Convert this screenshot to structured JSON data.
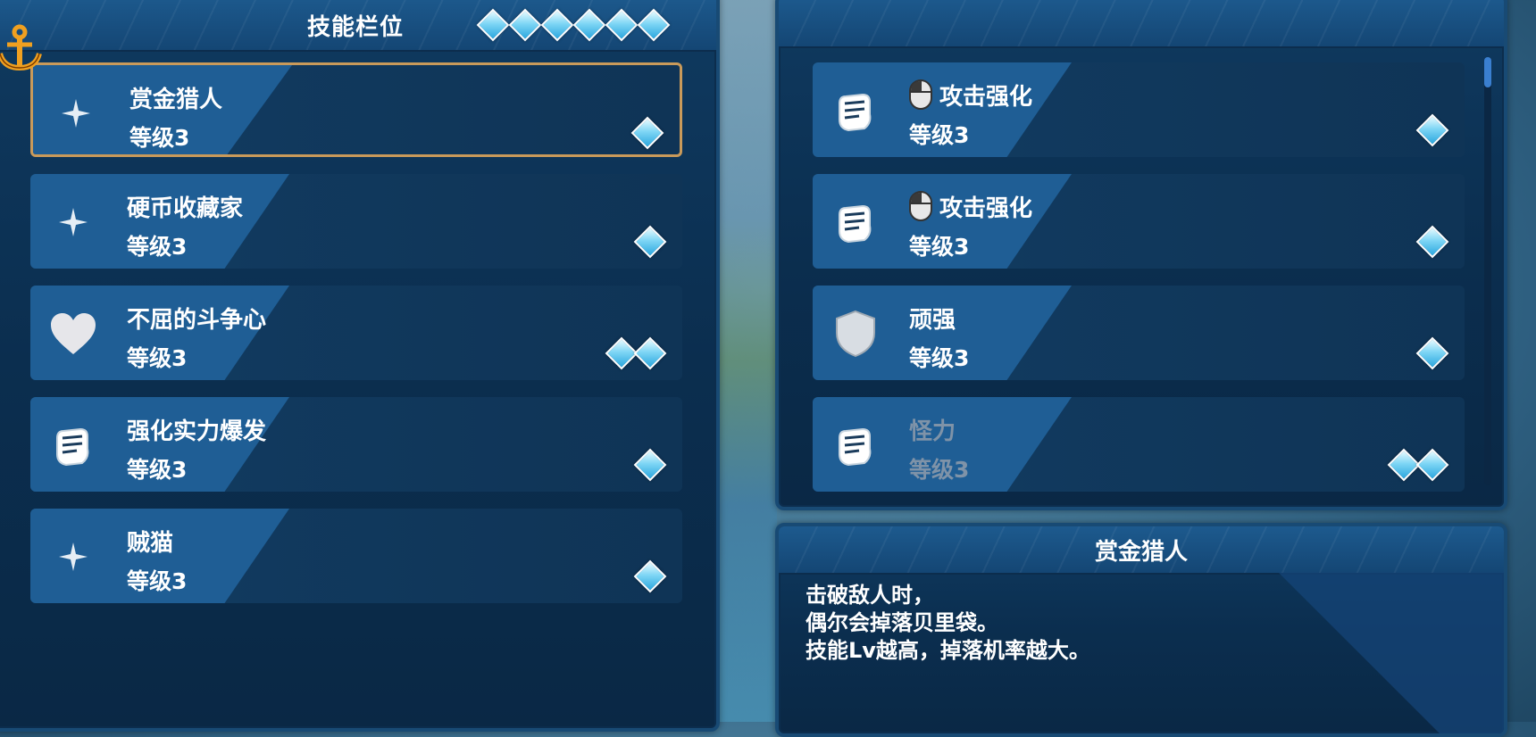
{
  "slots_panel": {
    "title": "技能栏位",
    "gem_count": 6,
    "skills": [
      {
        "name": "赏金猎人",
        "level": "等级3",
        "icon": "sparkle-icon",
        "cost": 1,
        "selected": true
      },
      {
        "name": "硬币收藏家",
        "level": "等级3",
        "icon": "sparkle-icon",
        "cost": 1
      },
      {
        "name": "不屈的斗争心",
        "level": "等级3",
        "icon": "heart-icon",
        "cost": 2
      },
      {
        "name": "强化实力爆发",
        "level": "等级3",
        "icon": "fist-icon",
        "cost": 1
      },
      {
        "name": "贼猫",
        "level": "等级3",
        "icon": "sparkle-icon",
        "cost": 1
      }
    ]
  },
  "available_panel": {
    "skills": [
      {
        "name": "攻击强化",
        "level": "等级3",
        "icon": "fist-icon",
        "mouse_icon": true,
        "cost": 1
      },
      {
        "name": "攻击强化",
        "level": "等级3",
        "icon": "fist-icon",
        "mouse_icon": true,
        "cost": 1
      },
      {
        "name": "顽强",
        "level": "等级3",
        "icon": "shield-icon",
        "cost": 1
      },
      {
        "name": "怪力",
        "level": "等级3",
        "icon": "fist-icon",
        "cost": 2,
        "disabled": true
      }
    ]
  },
  "description_panel": {
    "title": "赏金猎人",
    "text": "击破敌人时，\n偶尔会掉落贝里袋。\n技能Lv越高，掉落机率越大。"
  },
  "colors": {
    "panel": "#0b2e4f",
    "header": "#1d5a8e",
    "selected_border": "#c99a5a",
    "gem": "#7fd6f5"
  }
}
